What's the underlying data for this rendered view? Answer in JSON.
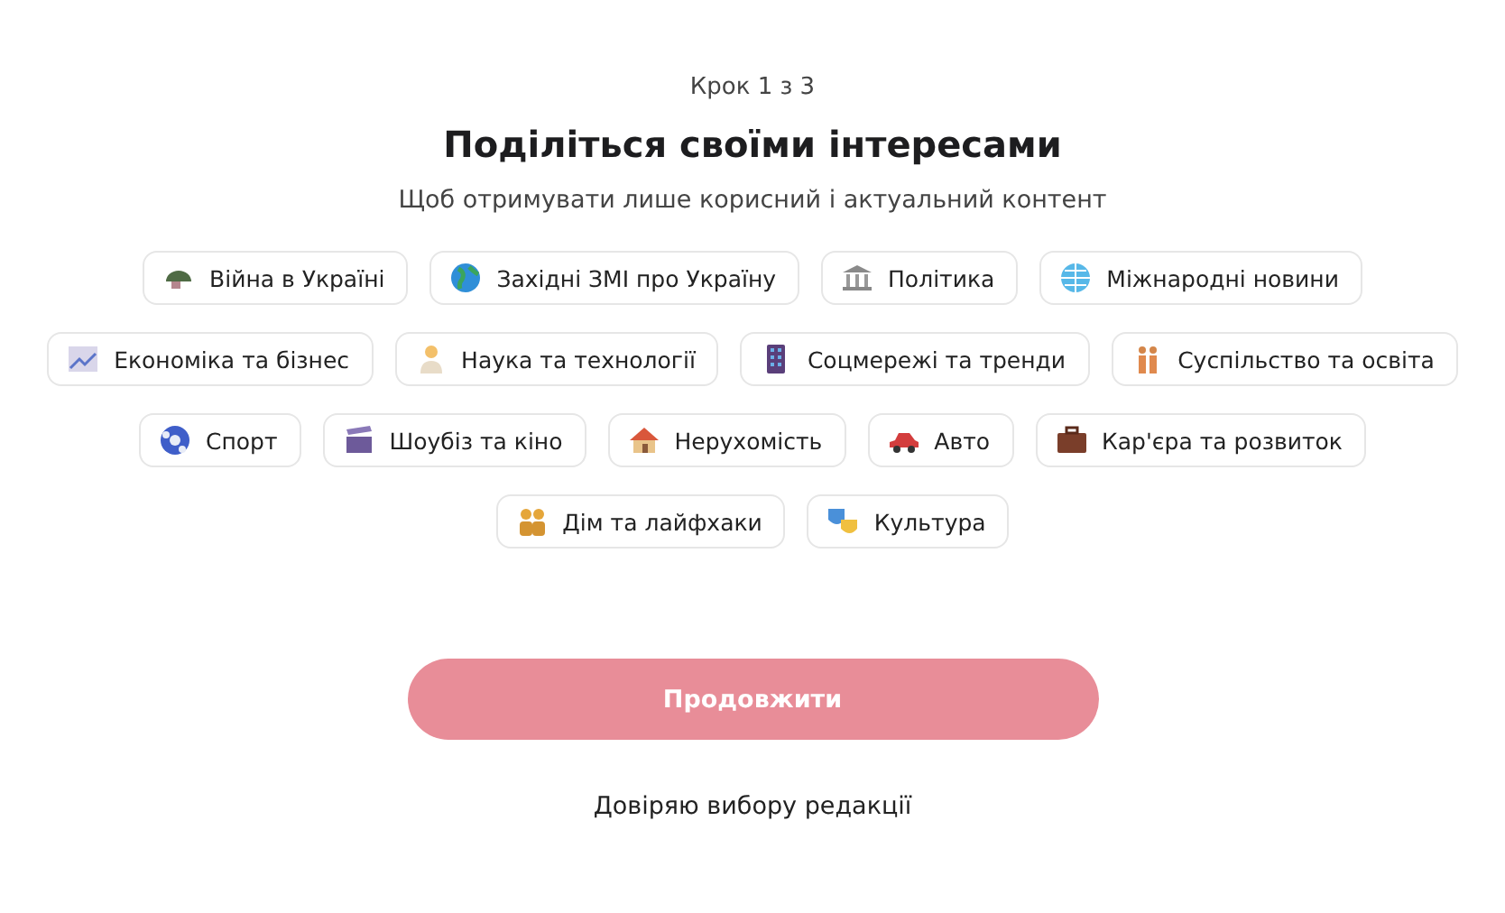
{
  "step": "Крок 1 з 3",
  "title": "Поділіться своїми інтересами",
  "subtitle": "Щоб отримувати лише корисний і актуальний контент",
  "rows": [
    [
      {
        "label": "Війна в Україні",
        "selected": false
      },
      {
        "label": "Західні ЗМІ про Україну",
        "selected": false
      },
      {
        "label": "Політика",
        "selected": false
      },
      {
        "label": "Міжнародні новини",
        "selected": false
      }
    ],
    [
      {
        "label": "Економіка та бізнес",
        "selected": false
      },
      {
        "label": "Наука та технології",
        "selected": false
      },
      {
        "label": "Соцмережі та тренди",
        "selected": false
      },
      {
        "label": "Суспільство та освіта",
        "selected": false
      }
    ],
    [
      {
        "label": "Спорт",
        "selected": false
      },
      {
        "label": "Шоубіз та кіно",
        "selected": false
      },
      {
        "label": "Нерухомість",
        "selected": false
      },
      {
        "label": "Авто",
        "selected": false
      },
      {
        "label": "Кар'єра та розвиток",
        "selected": false
      }
    ],
    [
      {
        "label": "Дім та лайфхаки",
        "selected": false
      },
      {
        "label": "Культура",
        "selected": false
      }
    ]
  ],
  "continue_button": {
    "label": "Продовжити",
    "disabled": true
  },
  "trust_link": "Довіряю вибору редакції"
}
